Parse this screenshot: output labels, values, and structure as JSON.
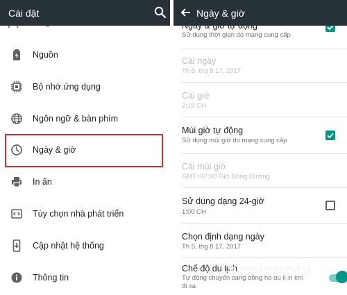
{
  "colors": {
    "appbar": "#263238",
    "accent": "#009688",
    "highlight_border": "#d32f2f"
  },
  "left": {
    "title": "Cài đặt",
    "search_icon": "search-icon",
    "items": [
      {
        "label": "Nguồn",
        "icon": "battery-icon"
      },
      {
        "label": "Bộ nhớ ứng dụng",
        "icon": "memory-icon"
      },
      {
        "label": "Ngôn ngữ & bàn phím",
        "icon": "globe-icon"
      },
      {
        "label": "Ngày & giờ",
        "icon": "clock-icon",
        "highlighted": true
      },
      {
        "label": "In ấn",
        "icon": "print-icon"
      },
      {
        "label": "Tùy chọn nhà phát triển",
        "icon": "code-icon"
      },
      {
        "label": "Cập nhật hệ thống",
        "icon": "system-update-icon"
      },
      {
        "label": "Thông tin",
        "icon": "info-icon"
      }
    ]
  },
  "right": {
    "title": "Ngày & giờ",
    "back_icon": "arrow-back-icon",
    "settings": [
      {
        "title": "Ngày & giờ tự động",
        "subtitle": "Sử dụng thời gian do mạng cung cấp",
        "checked": true
      },
      {
        "title": "Cài ngày",
        "subtitle": "Th 5, thg 8 17, 2017",
        "disabled": true
      },
      {
        "title": "Cài giờ",
        "subtitle": "2:19 CH",
        "disabled": true
      },
      {
        "title": "Múi giờ tự động",
        "subtitle": "Sử dụng múi giờ do mạng cung cấp",
        "checked": true
      },
      {
        "title": "Cài múi giờ",
        "subtitle": "GMT+07:00 Giờ Đông Dương",
        "disabled": true
      },
      {
        "title": "Sử dụng dạng 24-giờ",
        "subtitle": "1:00 CH",
        "checked": false
      },
      {
        "title": "Chọn định dạng ngày",
        "subtitle": "Th 5, thg 8 17, 2017"
      },
      {
        "title": "Chế độ du lịch",
        "subtitle": "Tự động chuyển sang đồng hồ du lịch khi",
        "subtitle2": "đi xa",
        "toggle": true
      }
    ]
  },
  "watermark": {
    "text": "Taimienphi",
    "suffix": ".vn"
  }
}
